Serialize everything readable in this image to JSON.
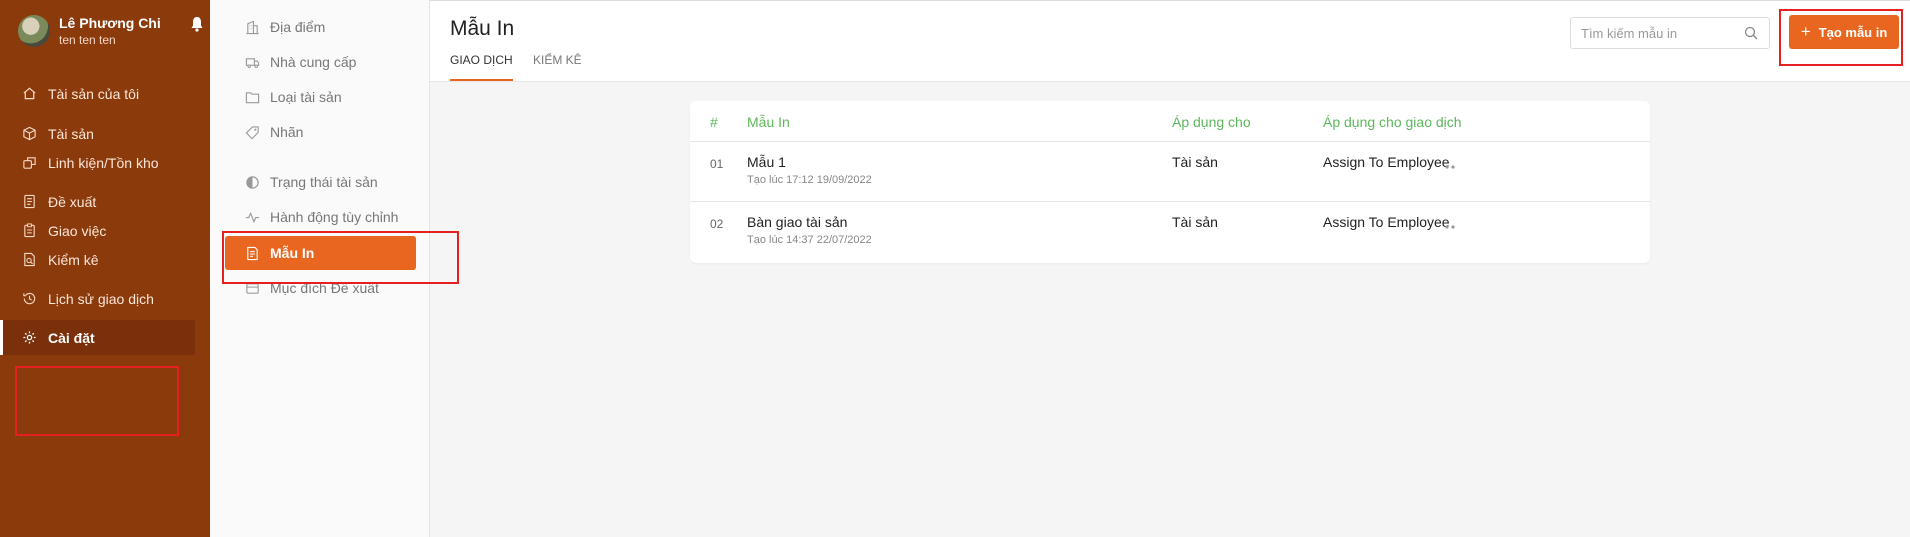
{
  "user": {
    "name": "Lê Phương Chi",
    "subtitle": "ten ten ten"
  },
  "sidebar": {
    "items": [
      {
        "label": "Tài sản của tôi",
        "icon": "home-icon"
      },
      {
        "label": "Tài sản",
        "icon": "box-icon"
      },
      {
        "label": "Linh kiện/Tồn kho",
        "icon": "components-icon"
      },
      {
        "label": "Đề xuất",
        "icon": "document-icon"
      },
      {
        "label": "Giao việc",
        "icon": "clipboard-icon"
      },
      {
        "label": "Kiểm kê",
        "icon": "inventory-icon"
      },
      {
        "label": "Lịch sử giao dịch",
        "icon": "history-icon"
      },
      {
        "label": "Cài đặt",
        "icon": "gear-icon",
        "active": true
      }
    ]
  },
  "settings_menu": {
    "items": [
      {
        "label": "Địa điểm",
        "icon": "building-icon"
      },
      {
        "label": "Nhà cung cấp",
        "icon": "truck-icon"
      },
      {
        "label": "Loại tài sản",
        "icon": "folder-icon"
      },
      {
        "label": "Nhãn",
        "icon": "tag-icon"
      },
      {
        "label": "Trạng thái tài sản",
        "icon": "half-circle-icon"
      },
      {
        "label": "Hành động tùy chỉnh",
        "icon": "activity-icon"
      },
      {
        "label": "Mẫu In",
        "icon": "print-template-icon",
        "active": true
      },
      {
        "label": "Mục đích Đề xuất",
        "icon": "purpose-icon"
      }
    ]
  },
  "header": {
    "title": "Mẫu In",
    "tabs": [
      {
        "label": "GIAO DỊCH",
        "active": true
      },
      {
        "label": "KIỂM KÊ",
        "active": false
      }
    ],
    "search_placeholder": "Tìm kiếm mẫu in",
    "create_label": "Tạo mẫu in"
  },
  "table": {
    "columns": [
      "#",
      "Mẫu In",
      "Áp dụng cho",
      "Áp dụng cho giao dịch"
    ],
    "rows": [
      {
        "num": "01",
        "name": "Mẫu 1",
        "created": "Tạo lúc 17:12 19/09/2022",
        "apply_to": "Tài sản",
        "transaction": "Assign To Employee"
      },
      {
        "num": "02",
        "name": "Bàn giao tài sản",
        "created": "Tạo lúc 14:37 22/07/2022",
        "apply_to": "Tài sản",
        "transaction": "Assign To Employee"
      }
    ]
  },
  "colors": {
    "sidebar_bg": "#8b3a0c",
    "accent": "#e8661f",
    "header_green": "#5cb85c",
    "annotation_red": "#e52020"
  }
}
